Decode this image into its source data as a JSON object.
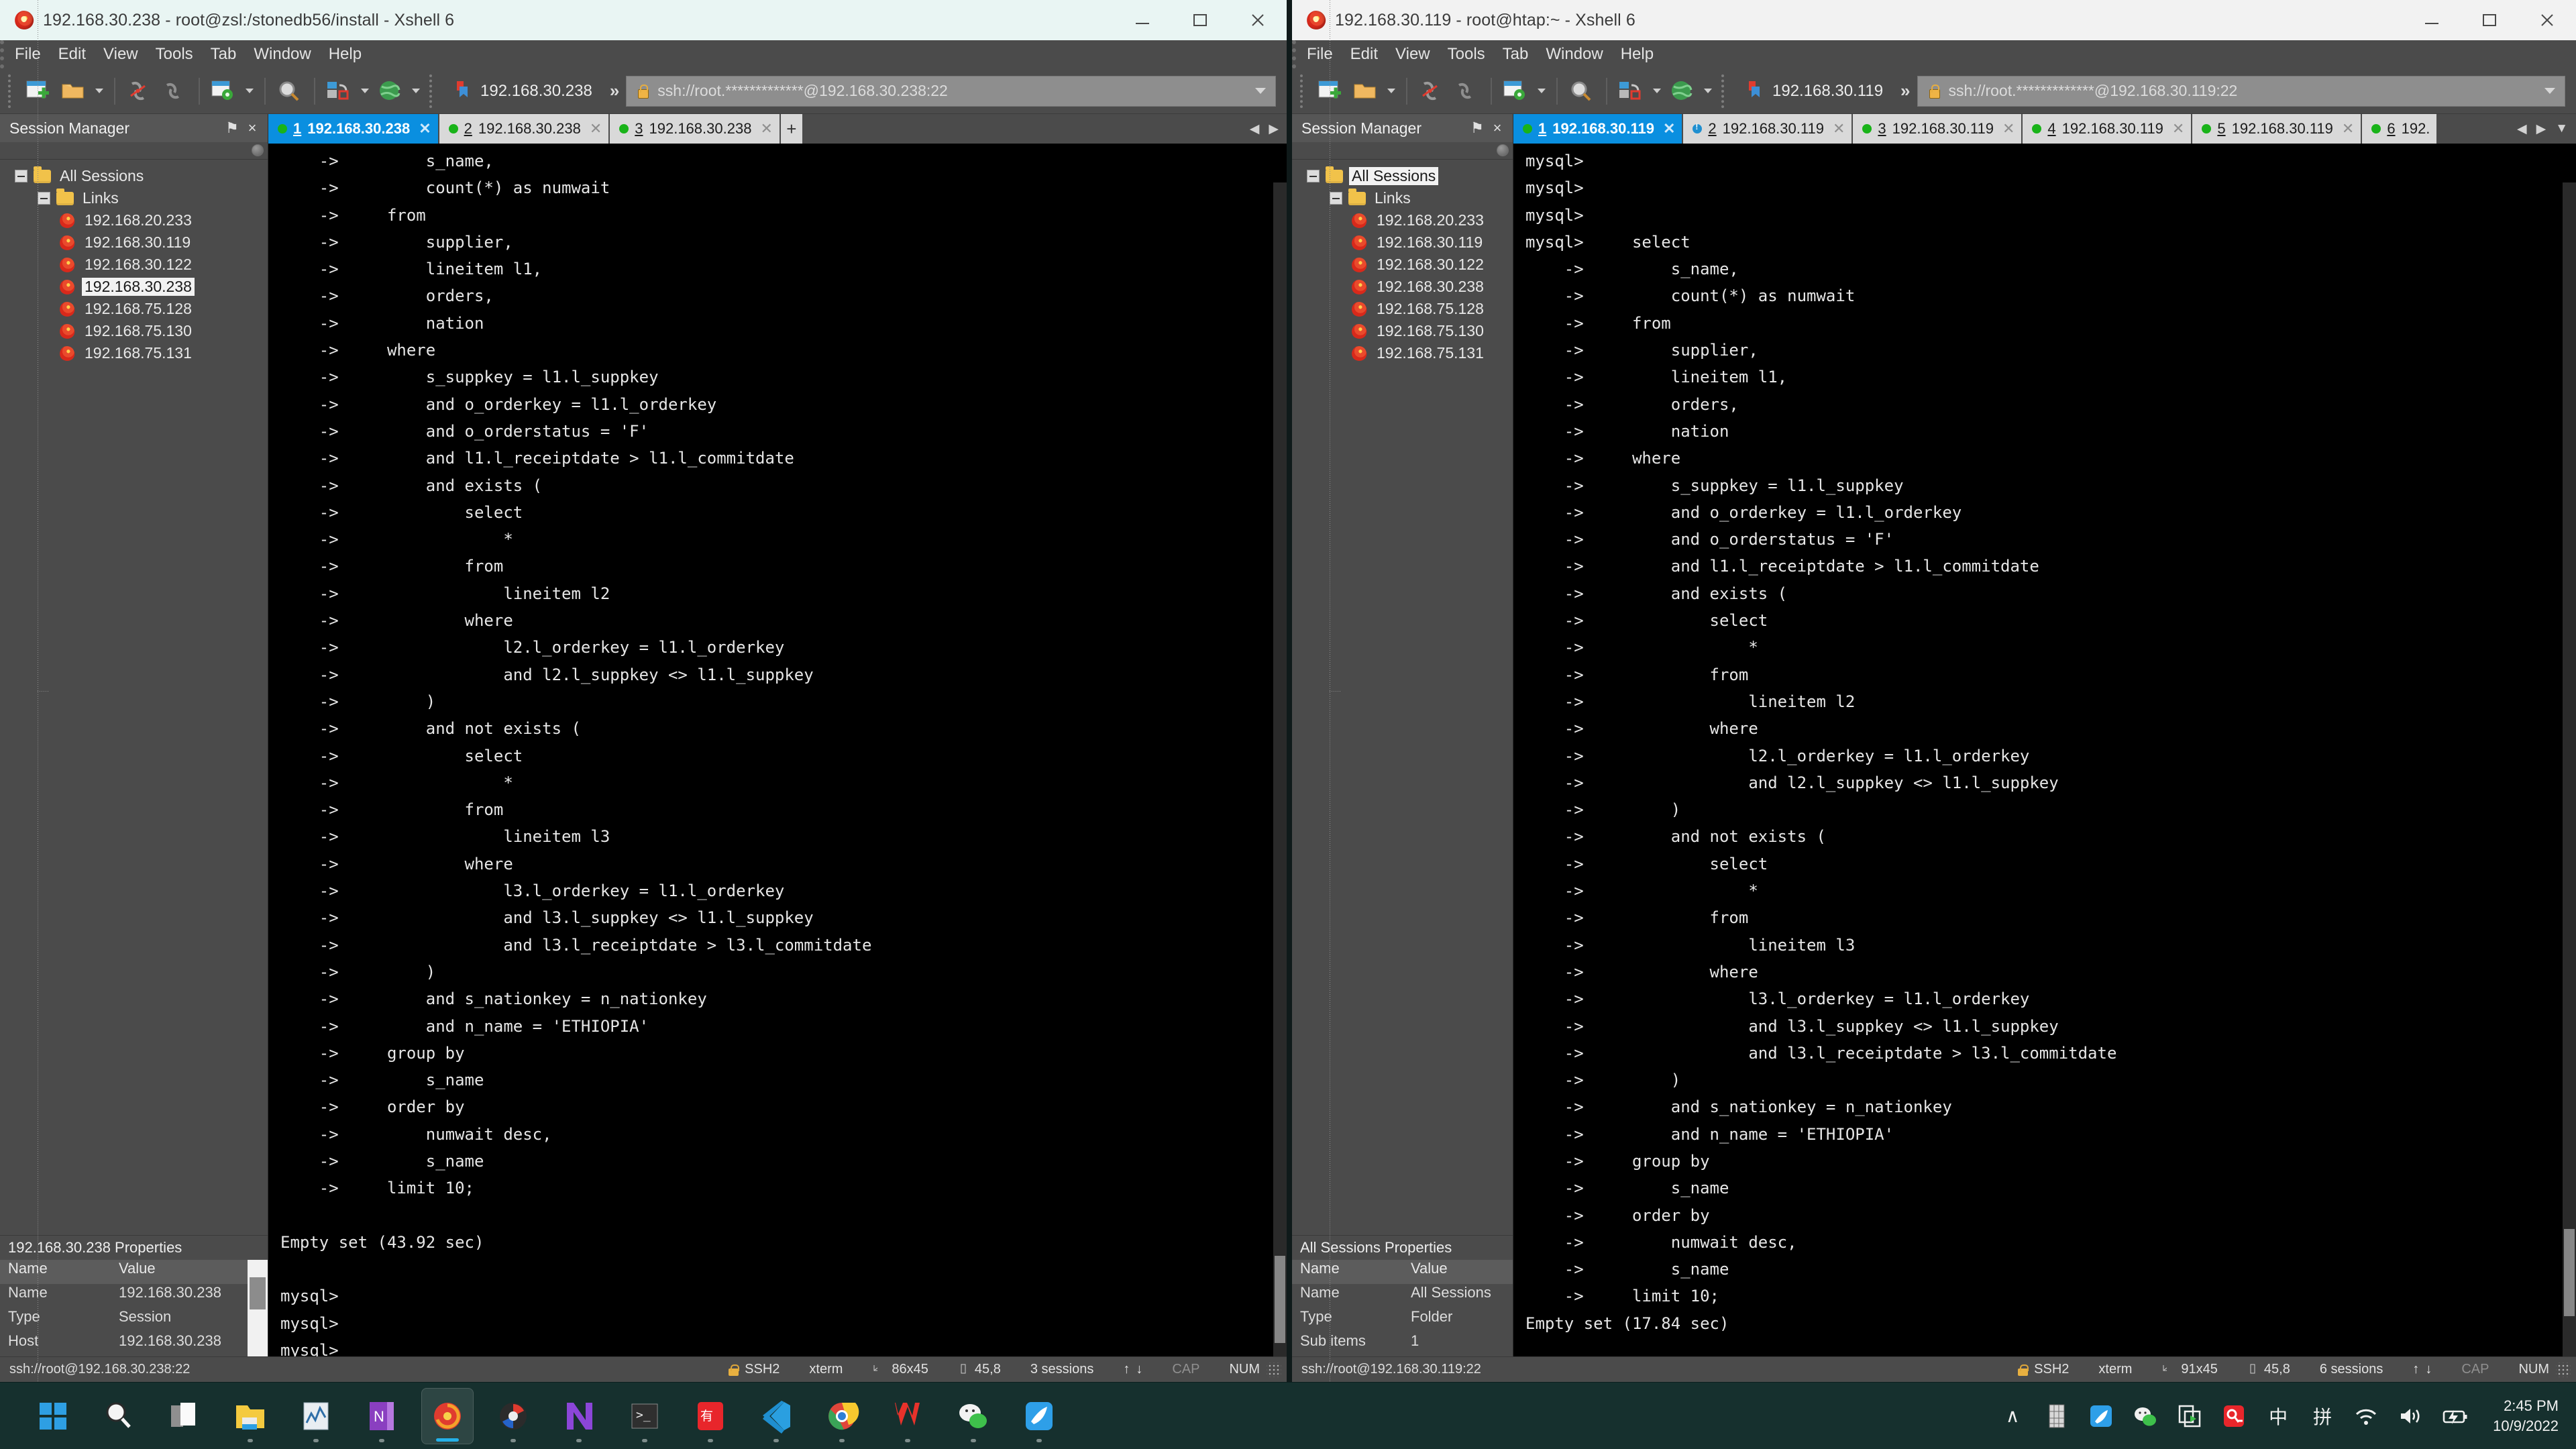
{
  "windows": [
    {
      "id": "left",
      "title": "192.168.30.238 - root@zsl:/stonedb56/install - Xshell 6",
      "menu": [
        "File",
        "Edit",
        "View",
        "Tools",
        "Tab",
        "Window",
        "Help"
      ],
      "toolbar": {
        "quick_session_label": "192.168.30.238",
        "overflow_label": "»",
        "address_value": "ssh://root.*************@192.168.30.238:22"
      },
      "session_panel": {
        "title": "Session Manager",
        "pin_label": "⚑",
        "close_label": "×",
        "tree": {
          "root": "All Sessions",
          "folder": "Links",
          "sessions": [
            "192.168.20.233",
            "192.168.30.119",
            "192.168.30.122",
            "192.168.30.238",
            "192.168.75.128",
            "192.168.75.130",
            "192.168.75.131"
          ],
          "selected": "192.168.30.238"
        },
        "properties": {
          "title": "192.168.30.238 Properties",
          "headers": [
            "Name",
            "Value"
          ],
          "rows": [
            [
              "Name",
              "192.168.30.238"
            ],
            [
              "Type",
              "Session"
            ],
            [
              "Host",
              "192.168.30.238"
            ]
          ]
        }
      },
      "tabs": [
        {
          "num": "1",
          "label": "192.168.30.238",
          "state": "ok",
          "active": true
        },
        {
          "num": "2",
          "label": "192.168.30.238",
          "state": "ok",
          "active": false
        },
        {
          "num": "3",
          "label": "192.168.30.238",
          "state": "ok",
          "active": false
        }
      ],
      "tab_add_label": "+",
      "terminal": "    ->         s_name,\n    ->         count(*) as numwait\n    ->     from\n    ->         supplier,\n    ->         lineitem l1,\n    ->         orders,\n    ->         nation\n    ->     where\n    ->         s_suppkey = l1.l_suppkey\n    ->         and o_orderkey = l1.l_orderkey\n    ->         and o_orderstatus = 'F'\n    ->         and l1.l_receiptdate > l1.l_commitdate\n    ->         and exists (\n    ->             select\n    ->                 *\n    ->             from\n    ->                 lineitem l2\n    ->             where\n    ->                 l2.l_orderkey = l1.l_orderkey\n    ->                 and l2.l_suppkey <> l1.l_suppkey\n    ->         )\n    ->         and not exists (\n    ->             select\n    ->                 *\n    ->             from\n    ->                 lineitem l3\n    ->             where\n    ->                 l3.l_orderkey = l1.l_orderkey\n    ->                 and l3.l_suppkey <> l1.l_suppkey\n    ->                 and l3.l_receiptdate > l3.l_commitdate\n    ->         )\n    ->         and s_nationkey = n_nationkey\n    ->         and n_name = 'ETHIOPIA'\n    ->     group by\n    ->         s_name\n    ->     order by\n    ->         numwait desc,\n    ->         s_name\n    ->     limit 10;\n\nEmpty set (43.92 sec)\n\nmysql>\nmysql>\nmysql> ",
      "status": {
        "url": "ssh://root@192.168.30.238:22",
        "protocol": "SSH2",
        "term_type": "xterm",
        "size": "86x45",
        "cursor": "45,8",
        "sessions": "3 sessions",
        "up": "↑",
        "down": "↓",
        "cap": "CAP",
        "num": "NUM"
      }
    },
    {
      "id": "right",
      "title": "192.168.30.119 - root@htap:~ - Xshell 6",
      "menu": [
        "File",
        "Edit",
        "View",
        "Tools",
        "Tab",
        "Window",
        "Help"
      ],
      "toolbar": {
        "quick_session_label": "192.168.30.119",
        "overflow_label": "»",
        "address_value": "ssh://root.*************@192.168.30.119:22"
      },
      "session_panel": {
        "title": "Session Manager",
        "pin_label": "⚑",
        "close_label": "×",
        "tree": {
          "root": "All Sessions",
          "folder": "Links",
          "sessions": [
            "192.168.20.233",
            "192.168.30.119",
            "192.168.30.122",
            "192.168.30.238",
            "192.168.75.128",
            "192.168.75.130",
            "192.168.75.131"
          ],
          "selected": "All Sessions"
        },
        "properties": {
          "title": "All Sessions Properties",
          "headers": [
            "Name",
            "Value"
          ],
          "rows": [
            [
              "Name",
              "All Sessions"
            ],
            [
              "Type",
              "Folder"
            ],
            [
              "Sub items",
              "1"
            ]
          ]
        }
      },
      "tabs": [
        {
          "num": "1",
          "label": "192.168.30.119",
          "state": "ok",
          "active": true
        },
        {
          "num": "2",
          "label": "192.168.30.119",
          "state": "warn",
          "active": false
        },
        {
          "num": "3",
          "label": "192.168.30.119",
          "state": "ok",
          "active": false
        },
        {
          "num": "4",
          "label": "192.168.30.119",
          "state": "ok",
          "active": false
        },
        {
          "num": "5",
          "label": "192.168.30.119",
          "state": "ok",
          "active": false
        },
        {
          "num": "6",
          "label": "192.",
          "state": "ok",
          "active": false
        }
      ],
      "tab_nav": {
        "prev": "◀",
        "next": "▶",
        "menu": "▼"
      },
      "terminal": "mysql>\nmysql>\nmysql>\nmysql>     select\n    ->         s_name,\n    ->         count(*) as numwait\n    ->     from\n    ->         supplier,\n    ->         lineitem l1,\n    ->         orders,\n    ->         nation\n    ->     where\n    ->         s_suppkey = l1.l_suppkey\n    ->         and o_orderkey = l1.l_orderkey\n    ->         and o_orderstatus = 'F'\n    ->         and l1.l_receiptdate > l1.l_commitdate\n    ->         and exists (\n    ->             select\n    ->                 *\n    ->             from\n    ->                 lineitem l2\n    ->             where\n    ->                 l2.l_orderkey = l1.l_orderkey\n    ->                 and l2.l_suppkey <> l1.l_suppkey\n    ->         )\n    ->         and not exists (\n    ->             select\n    ->                 *\n    ->             from\n    ->                 lineitem l3\n    ->             where\n    ->                 l3.l_orderkey = l1.l_orderkey\n    ->                 and l3.l_suppkey <> l1.l_suppkey\n    ->                 and l3.l_receiptdate > l3.l_commitdate\n    ->         )\n    ->         and s_nationkey = n_nationkey\n    ->         and n_name = 'ETHIOPIA'\n    ->     group by\n    ->         s_name\n    ->     order by\n    ->         numwait desc,\n    ->         s_name\n    ->     limit 10;\nEmpty set (17.84 sec)",
      "status": {
        "url": "ssh://root@192.168.30.119:22",
        "protocol": "SSH2",
        "term_type": "xterm",
        "size": "91x45",
        "cursor": "45,8",
        "sessions": "6 sessions",
        "up": "↑",
        "down": "↓",
        "cap": "CAP",
        "num": "NUM"
      }
    }
  ],
  "taskbar": {
    "apps": [
      {
        "name": "start-button",
        "icon": "windows-logo"
      },
      {
        "name": "search",
        "icon": "search-icon"
      },
      {
        "name": "task-view",
        "icon": "task-view-icon"
      },
      {
        "name": "file-explorer",
        "icon": "folder-icon"
      },
      {
        "name": "monitor-app",
        "icon": "chart-icon"
      },
      {
        "name": "onenote",
        "icon": "onenote-icon"
      },
      {
        "name": "xshell",
        "icon": "xshell-icon"
      },
      {
        "name": "xftp",
        "icon": "xftp-icon"
      },
      {
        "name": "navicat",
        "icon": "navicat-icon"
      },
      {
        "name": "terminal",
        "icon": "terminal-icon"
      },
      {
        "name": "youdao",
        "icon": "youdao-icon"
      },
      {
        "name": "vscode",
        "icon": "vscode-icon"
      },
      {
        "name": "chrome",
        "icon": "chrome-icon"
      },
      {
        "name": "wps",
        "icon": "wps-icon"
      },
      {
        "name": "wechat",
        "icon": "wechat-icon"
      },
      {
        "name": "feishu",
        "icon": "feishu-icon"
      }
    ],
    "tray": [
      {
        "name": "show-hidden-icons",
        "glyph": "∧"
      },
      {
        "name": "grid-icon",
        "glyph": "▒"
      },
      {
        "name": "feishu-tray-icon",
        "glyph": ""
      },
      {
        "name": "wechat-tray-icon",
        "glyph": ""
      },
      {
        "name": "screen-record-icon",
        "glyph": ""
      },
      {
        "name": "qq-input-icon",
        "glyph": ""
      },
      {
        "name": "ime-mode-icon",
        "glyph": "中"
      },
      {
        "name": "ime-pinyin-icon",
        "glyph": "拼"
      },
      {
        "name": "wifi-icon",
        "glyph": ""
      },
      {
        "name": "volume-icon",
        "glyph": ""
      },
      {
        "name": "battery-icon",
        "glyph": ""
      }
    ],
    "clock": {
      "time": "2:45 PM",
      "date": "10/9/2022"
    }
  }
}
